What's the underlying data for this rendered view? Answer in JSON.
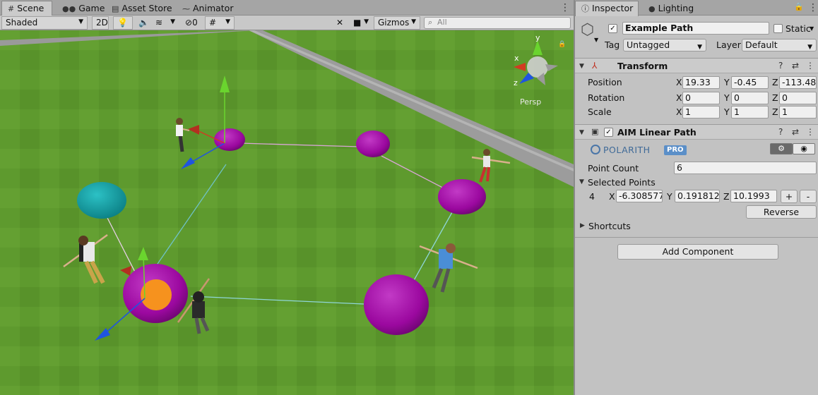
{
  "scene_tabs": [
    {
      "label": "Scene",
      "icon": "grid-icon"
    },
    {
      "label": "Game",
      "icon": "gamepad-icon"
    },
    {
      "label": "Asset Store",
      "icon": "store-icon"
    },
    {
      "label": "Animator",
      "icon": "animator-icon"
    }
  ],
  "scene_toolbar": {
    "shading_mode": "Shaded",
    "two_d_label": "2D",
    "hidden_count": "0",
    "gizmos_label": "Gizmos",
    "search_placeholder": "All"
  },
  "viewport": {
    "persp_label": "Persp",
    "axis_labels": {
      "x": "x",
      "y": "y",
      "z": "z"
    },
    "colors": {
      "grass": "#5e9a2e",
      "road": "#9c9c9c",
      "waypoint": "#a10aa6",
      "waypoint_selected_start": "#11a3a8",
      "selected_point_marker": "#f6921e",
      "gizmo_x": "#d23a22",
      "gizmo_y": "#6ad42e",
      "gizmo_z": "#1f54e0"
    }
  },
  "inspector_tabs": [
    {
      "label": "Inspector",
      "icon": "info-icon"
    },
    {
      "label": "Lighting",
      "icon": "lightbulb-icon"
    }
  ],
  "object": {
    "name": "Example Path",
    "active": true,
    "static_label": "Static",
    "tag_label": "Tag",
    "tag_value": "Untagged",
    "layer_label": "Layer",
    "layer_value": "Default"
  },
  "transform": {
    "title": "Transform",
    "rows": [
      {
        "label": "Position",
        "x": "19.33",
        "y": "-0.45",
        "z": "-113.48"
      },
      {
        "label": "Rotation",
        "x": "0",
        "y": "0",
        "z": "0"
      },
      {
        "label": "Scale",
        "x": "1",
        "y": "1",
        "z": "1"
      }
    ]
  },
  "aim_path": {
    "title": "AIM Linear Path",
    "enabled": true,
    "brand_text": "POLARITH",
    "pro_label": "PRO",
    "point_count_label": "Point Count",
    "point_count": "6",
    "selected_points_label": "Selected Points",
    "selected": {
      "index": "4",
      "x": "-6.308577",
      "y": "0.1918123",
      "z": "10.1993"
    },
    "plus_label": "+",
    "minus_label": "-",
    "reverse_label": "Reverse",
    "shortcuts_label": "Shortcuts"
  },
  "add_component_label": "Add Component"
}
